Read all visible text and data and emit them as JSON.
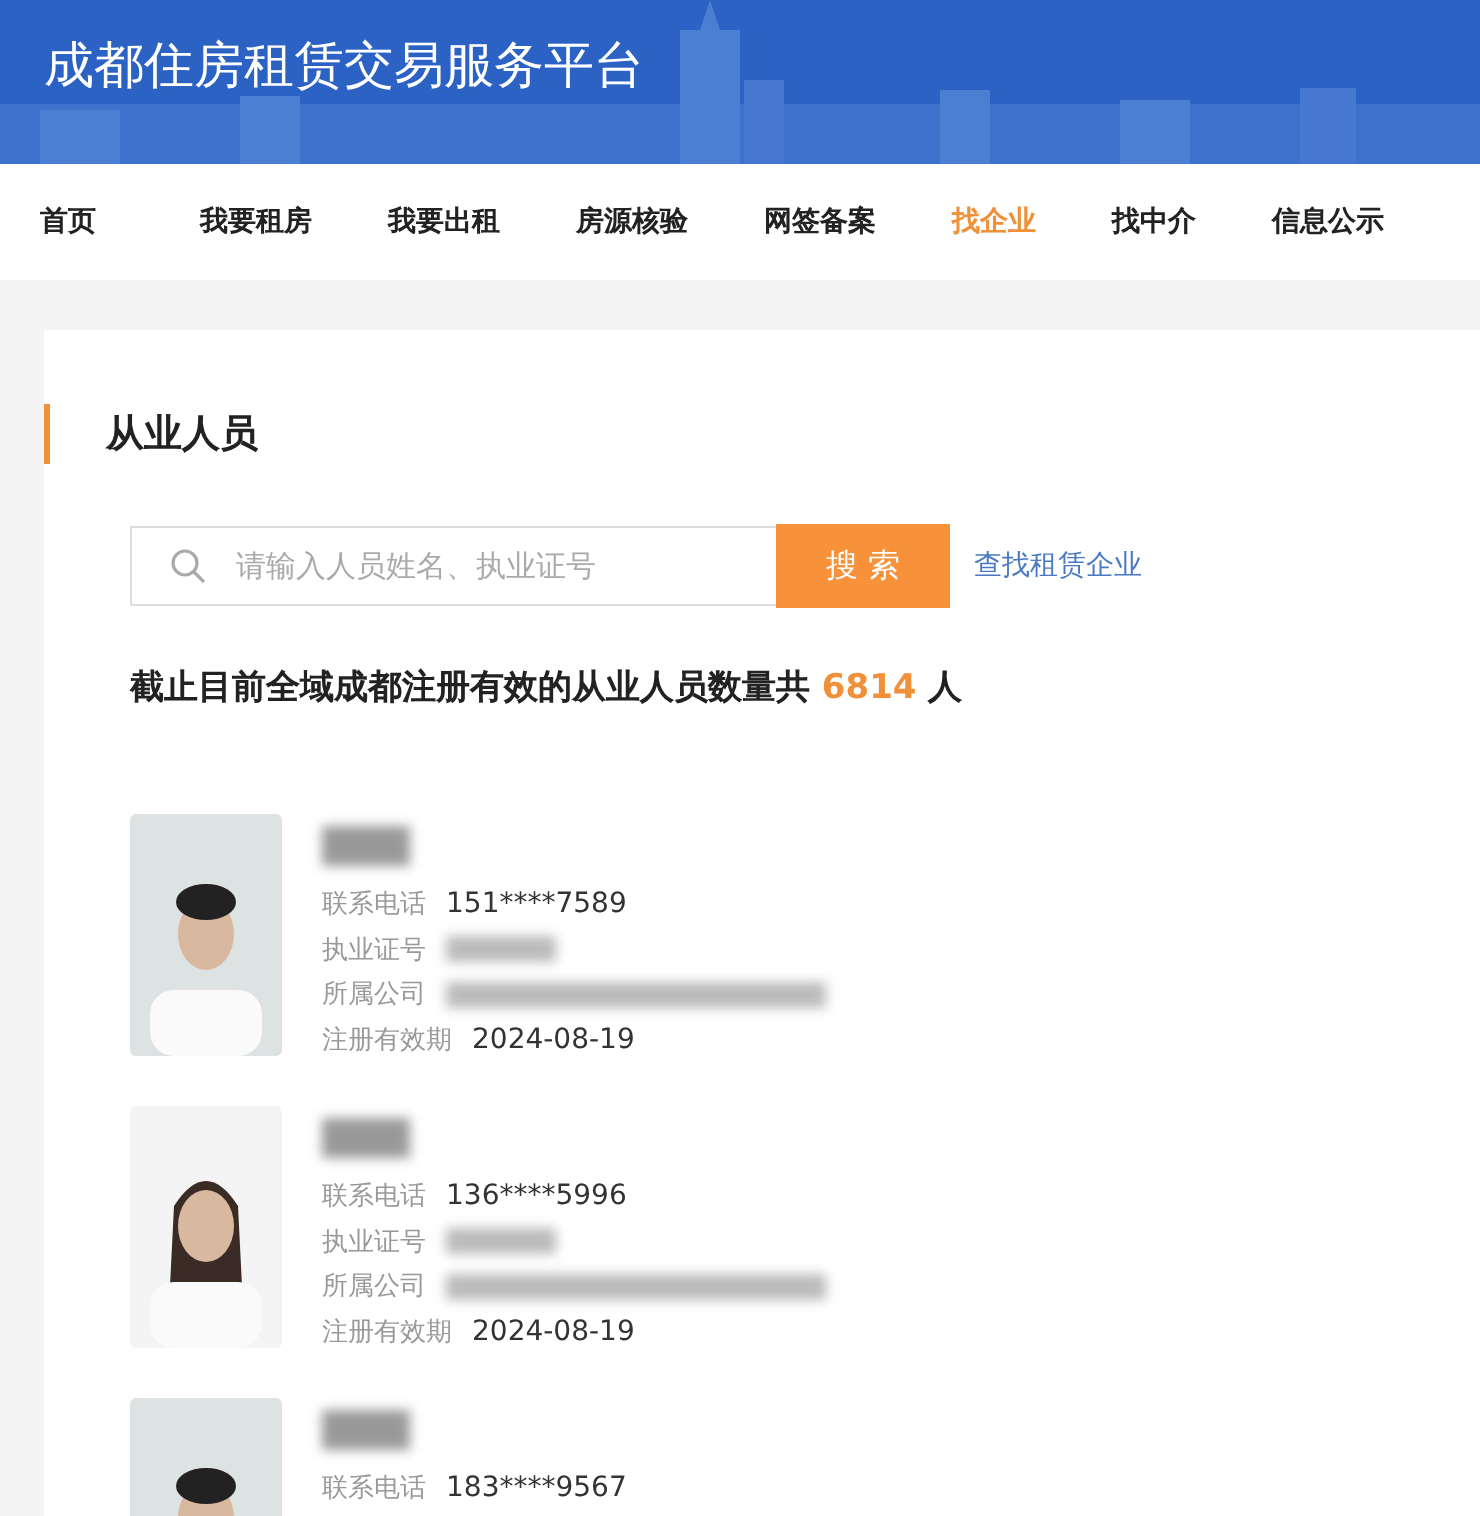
{
  "header": {
    "title": "成都住房租赁交易服务平台"
  },
  "nav": [
    {
      "label": "首页",
      "selected": false
    },
    {
      "label": "我要租房",
      "selected": false
    },
    {
      "label": "我要出租",
      "selected": false
    },
    {
      "label": "房源核验",
      "selected": false
    },
    {
      "label": "网签备案",
      "selected": false
    },
    {
      "label": "找企业",
      "selected": true
    },
    {
      "label": "找中介",
      "selected": false
    },
    {
      "label": "信息公示",
      "selected": false
    }
  ],
  "section": {
    "title": "从业人员"
  },
  "search": {
    "placeholder": "请输入人员姓名、执业证号",
    "button": "搜 索",
    "link": "查找租赁企业"
  },
  "summary": {
    "text": "截止目前全域成都注册有效的从业人员数量共",
    "count": "6814",
    "unit": "人"
  },
  "people": [
    {
      "fields": [
        {
          "label": "联系电话",
          "kind": "text",
          "value": "151****7589"
        },
        {
          "label": "执业证号",
          "kind": "redacted"
        },
        {
          "label": "所属公司",
          "kind": "redacted"
        },
        {
          "label": "注册有效期",
          "kind": "text",
          "value": "2024-08-19"
        }
      ]
    },
    {
      "fields": [
        {
          "label": "联系电话",
          "kind": "text",
          "value": "136****5996"
        },
        {
          "label": "执业证号",
          "kind": "redacted"
        },
        {
          "label": "所属公司",
          "kind": "redacted"
        },
        {
          "label": "注册有效期",
          "kind": "text",
          "value": "2024-08-19"
        }
      ]
    },
    {
      "fields": [
        {
          "label": "联系电话",
          "kind": "text",
          "value": "183****9567"
        }
      ]
    }
  ]
}
